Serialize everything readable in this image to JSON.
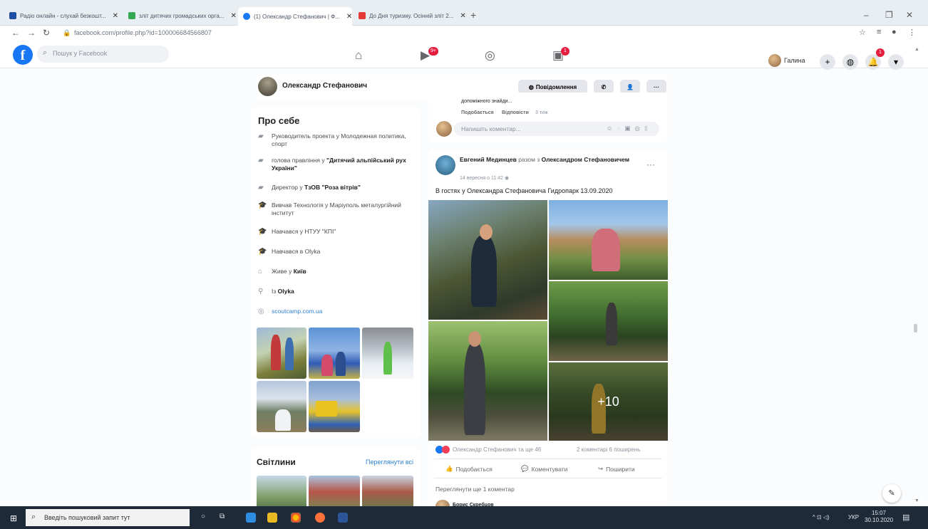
{
  "browser": {
    "tabs": [
      {
        "title": "Радіо онлайн - слухай безкошт...",
        "favicon_color": "#1d4fa3"
      },
      {
        "title": "зліт дитячих громадських орга...",
        "favicon_color": "#34a853"
      },
      {
        "title": "(1) Олександр Стефанович | Ф...",
        "favicon_color": "#1877f2",
        "active": true
      },
      {
        "title": "До Дня туризму. Осінній зліт 2...",
        "favicon_color": "#e53935"
      }
    ],
    "url": "facebook.com/profile.php?id=100006684566807"
  },
  "facebook": {
    "search_placeholder": "Пошук у Facebook",
    "nav_badges": {
      "watch": "9+",
      "gaming": "1"
    },
    "user_name": "Галина",
    "notif_count": "1",
    "profile": {
      "name": "Олександр Стефанович",
      "message_label": "Повідомлення"
    },
    "about": {
      "title": "Про себе",
      "items": [
        {
          "icon": "briefcase-icon",
          "text": "Руководитель проекта у Молодежная политика, спорт",
          "bold": ""
        },
        {
          "icon": "briefcase-icon",
          "text": "голова правління у ",
          "bold": "\"Дитячий альпійський рух України\""
        },
        {
          "icon": "briefcase-icon",
          "text": "Директор у ",
          "bold": "ТзОВ \"Роза вітрів\""
        },
        {
          "icon": "graduation-cap-icon",
          "text": "Вивчав Технологія у Маріуполь металургійний інститут",
          "bold": ""
        },
        {
          "icon": "graduation-cap-icon",
          "text": "Навчався у НТУУ \"КПІ\"",
          "bold": ""
        },
        {
          "icon": "graduation-cap-icon",
          "text": "Навчався в Olyka",
          "bold": ""
        },
        {
          "icon": "home-icon",
          "text": "Живе у ",
          "bold": "Київ"
        },
        {
          "icon": "location-pin-icon",
          "text": "Із ",
          "bold": "Olyka"
        },
        {
          "icon": "globe-icon",
          "text": "",
          "link": "scoutcamp.com.ua"
        }
      ]
    },
    "photos": {
      "title": "Світлини",
      "see_all": "Переглянути всі"
    },
    "top_card": {
      "snippet": "допоміжного знайди...",
      "like": "Подобається",
      "reply": "Відповісти",
      "time": "3 тиж",
      "comment_placeholder": "Напишіть коментар..."
    },
    "post": {
      "author": "Евгений Мединцев",
      "with_text": "разом з",
      "tagged": "Олександром Стефановичем",
      "date": "14 вересня о 11:42",
      "text": "В гостях у Олександра Стефановича Гидропарк 13.09.2020",
      "more_photos": "+10",
      "reactions": "Олександр Стефанович та ще 46",
      "counts": "2 коментарі 6 поширень",
      "like_label": "Подобається",
      "comment_label": "Коментувати",
      "share_label": "Поширити",
      "view_more": "Переглянути ще 1 коментар",
      "next_commenter": "Борис Скребцов"
    }
  },
  "taskbar": {
    "search_placeholder": "Введіть пошуковий запит тут",
    "lang": "УКР",
    "time": "15:07",
    "date": "30.10.2020"
  }
}
